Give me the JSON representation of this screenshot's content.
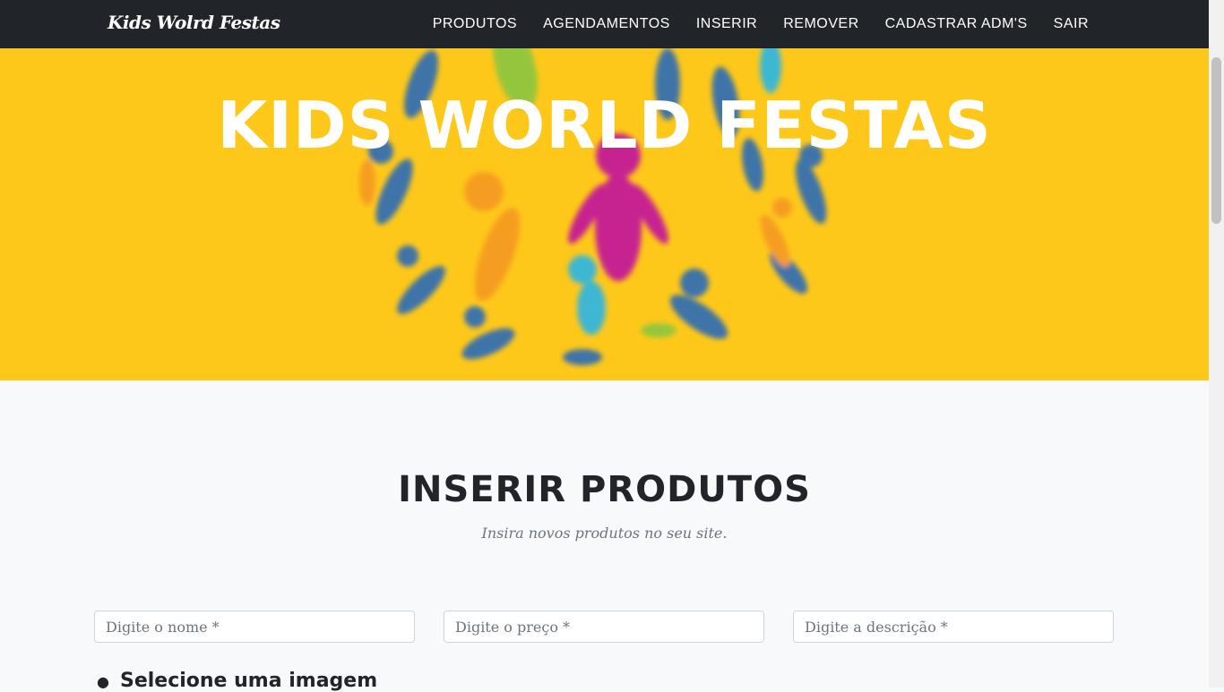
{
  "nav": {
    "brand": "Kids Wolrd Festas",
    "links": [
      "PRODUTOS",
      "AGENDAMENTOS",
      "INSERIR",
      "REMOVER",
      "CADASTRAR ADM'S",
      "SAIR"
    ]
  },
  "hero": {
    "title": "KIDS WORLD FESTAS",
    "background_color": "#fec81a"
  },
  "section": {
    "heading": "INSERIR PRODUTOS",
    "subheading": "Insira novos produtos no seu site."
  },
  "form": {
    "name_placeholder": "Digite o nome *",
    "price_placeholder": "Digite o preço *",
    "description_placeholder": "Digite a descrição *",
    "image_label": "Selecione uma imagem"
  },
  "colors": {
    "navbar": "#212529",
    "accent": "#fec81a",
    "page_bg": "#f8f9fa"
  }
}
